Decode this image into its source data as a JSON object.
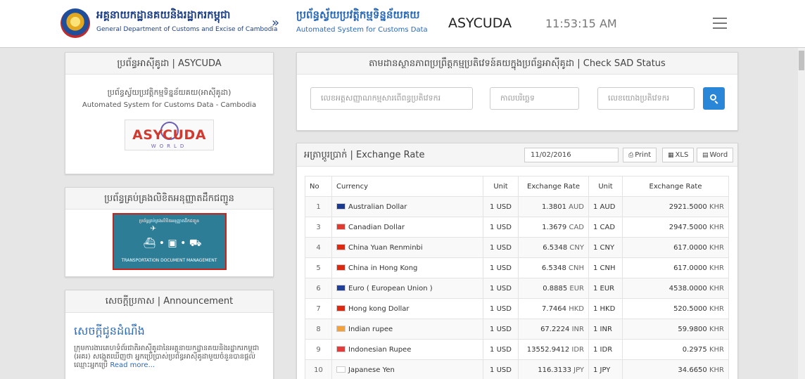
{
  "header": {
    "dept_kh": "អគ្គនាយកដ្ឋានគយនិងរដ្ឋាករកម្ពុជា",
    "dept_en": "General Department of Customs and Excise of Cambodia",
    "separator": "»",
    "system_kh": "ប្រព័ន្ធស្វ័យប្រវត្តិកម្មទិន្នន័យគយ",
    "system_en": "Automated System for Customs Data",
    "brand": "ASYCUDA",
    "time": "11:53:15 AM"
  },
  "asycuda_panel": {
    "title": "ប្រព័ន្ធអាស៊ីគូដា | ASYCUDA",
    "desc_kh": "ប្រព័ន្ធស្វ័យប្រវត្តិកម្មទិន្នន័យគយ(អាស៊ីគូដា)",
    "desc_en": "Automated System for Customs Data - Cambodia",
    "logo_text": "ASYCUDA",
    "logo_sub": "WORLD"
  },
  "tdm_panel": {
    "title": "ប្រព័ន្ធគ្រប់គ្រងលិខិតអនុញ្ញាតដឹកជញ្ជូន",
    "banner_top": "ប្រព័ន្ធគ្រប់គ្រងលិខិតអនុញ្ញាតដឹកជញ្ជូន",
    "banner_bottom": "TRANSPORTATION DOCUMENT MANAGEMENT"
  },
  "announcement": {
    "title": "សេចក្តីប្រកាស | Announcement",
    "headline": "សេចក្តីជូនដំណឹង",
    "body": "ក្រុមការងារគេហទំព័រជាតិអាស៊ីគូដានៃអគ្គនាយកដ្ឋានគយនិងរដ្ឋាករកម្ពុជា (អគរ) សង្កេតឃើញថា អ្នកប្រើប្រាស់ប្រព័ន្ធអាស៊ីគូដាមួយចំនួនបានផ្តល់ឈ្មោះអ្នកប្រើ",
    "read_more": "Read more..."
  },
  "sad_check": {
    "title": "តាមដានស្ថានភាពប្រព្រឹត្តកម្មប្រតិវេទន៍គយក្នុងប្រព័ន្ធអាស៊ីគូដា | Check SAD Status",
    "ph_office": "លេខអត្តសញ្ញាណកម្មសារពើពន្ធប្រតិវេទករ",
    "ph_date": "កាលបរិច្ឆេទ",
    "ph_ref": "លេខយោងប្រតិវេទករ",
    "search_icon": "search-icon"
  },
  "exchange": {
    "title": "អត្រាប្តូរប្រាក់ | Exchange Rate",
    "date": "11/02/2016",
    "print_label": "Print",
    "xls_label": "XLS",
    "word_label": "Word",
    "columns": [
      "No",
      "Currency",
      "Unit",
      "Exchange Rate",
      "Unit",
      "Exchange Rate"
    ],
    "rows": [
      {
        "no": "1",
        "currency": "Australian Dollar",
        "unit": "1 USD",
        "rate": "1.3801",
        "code": "AUD",
        "unit2": "1 AUD",
        "khr": "2921.5000",
        "khr_code": "KHR",
        "flag": "#1a3a8f"
      },
      {
        "no": "3",
        "currency": "Canadian Dollar",
        "unit": "1 USD",
        "rate": "1.3679",
        "code": "CAD",
        "unit2": "1 CAD",
        "khr": "2947.5000",
        "khr_code": "KHR",
        "flag": "#e23a2f"
      },
      {
        "no": "4",
        "currency": "China Yuan Renminbi",
        "unit": "1 USD",
        "rate": "6.5348",
        "code": "CNY",
        "unit2": "1 CNY",
        "khr": "617.0000",
        "khr_code": "KHR",
        "flag": "#de2910"
      },
      {
        "no": "5",
        "currency": "China in Hong Kong",
        "unit": "1 USD",
        "rate": "6.5348",
        "code": "CNH",
        "unit2": "1 CNH",
        "khr": "617.0000",
        "khr_code": "KHR",
        "flag": "#de2910"
      },
      {
        "no": "6",
        "currency": "Euro ( European Union )",
        "unit": "1 USD",
        "rate": "0.8885",
        "code": "EUR",
        "unit2": "1 EUR",
        "khr": "4538.0000",
        "khr_code": "KHR",
        "flag": "#1f3f99"
      },
      {
        "no": "7",
        "currency": "Hong kong Dollar",
        "unit": "1 USD",
        "rate": "7.7464",
        "code": "HKD",
        "unit2": "1 HKD",
        "khr": "520.5000",
        "khr_code": "KHR",
        "flag": "#de2910"
      },
      {
        "no": "8",
        "currency": "Indian rupee",
        "unit": "1 USD",
        "rate": "67.2224",
        "code": "INR",
        "unit2": "1 INR",
        "khr": "59.9800",
        "khr_code": "KHR",
        "flag": "#f4a13a"
      },
      {
        "no": "9",
        "currency": "Indonesian Rupee",
        "unit": "1 USD",
        "rate": "13552.9412",
        "code": "IDR",
        "unit2": "1 IDR",
        "khr": "0.2975",
        "khr_code": "KHR",
        "flag": "#e53b3b"
      },
      {
        "no": "10",
        "currency": "Japanese Yen",
        "unit": "1 USD",
        "rate": "116.3133",
        "code": "JPY",
        "unit2": "1 JPY",
        "khr": "34.6650",
        "khr_code": "KHR",
        "flag": "#ffffff"
      }
    ]
  }
}
